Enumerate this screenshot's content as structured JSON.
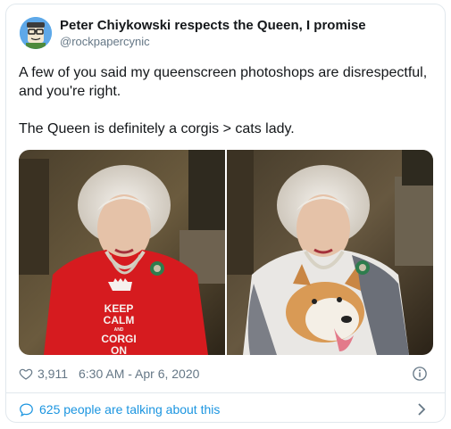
{
  "author": {
    "display_name": "Peter Chiykowski respects the Queen, I promise",
    "handle": "@rockpapercynic",
    "avatar_icon": "cartoon-avatar-icon"
  },
  "tweet": {
    "line1": "A few of you said my queenscreen photoshops are disrespectful,",
    "line2": "and you're right.",
    "line3": "The Queen is definitely a corgis > cats lady."
  },
  "media": {
    "left_photo": {
      "shirt_text": [
        "KEEP",
        "CALM",
        "AND",
        "CORGI",
        "ON"
      ]
    }
  },
  "meta": {
    "likes": "3,911",
    "timestamp": "6:30 AM - Apr 6, 2020"
  },
  "footer": {
    "talking": "625 people are talking about this"
  },
  "colors": {
    "link": "#1b95e0",
    "muted": "#657786",
    "border": "#e1e8ed"
  }
}
